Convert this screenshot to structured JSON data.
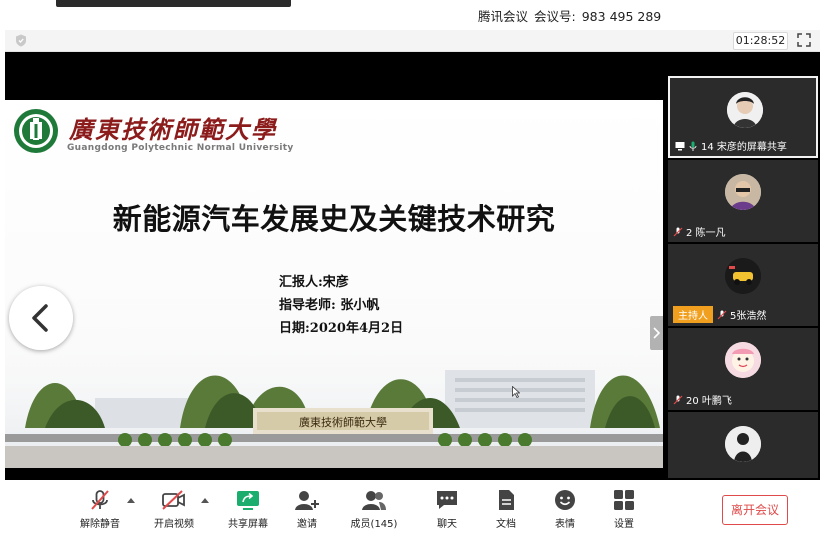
{
  "window": {
    "meeting_app": "腾讯会议",
    "meeting_id_label": "会议号:",
    "meeting_id": "983 495 289",
    "elapsed_time": "01:28:52"
  },
  "slide": {
    "university_cn": "廣東技術師範大學",
    "university_en": "Guangdong Polytechnic Normal University",
    "title": "新能源汽车发展史及关键技术研究",
    "lines": [
      "汇报人:宋彦",
      "指导老师: 张小帆",
      "日期:2020年4月2日"
    ],
    "gate_text": "廣東技術師範大學"
  },
  "participants": [
    {
      "name": "14 宋彦的屏幕共享",
      "sharing": true
    },
    {
      "name": "2 陈一凡",
      "muted": true
    },
    {
      "name": "5张浩然",
      "muted": true,
      "role": "主持人"
    },
    {
      "name": "20 叶鹏飞",
      "muted": true
    },
    {
      "name": "",
      "muted": true
    }
  ],
  "toolbar": {
    "items": [
      {
        "label": "解除静音",
        "icon": "mic-muted-icon"
      },
      {
        "label": "开启视频",
        "icon": "video-off-icon"
      },
      {
        "label": "共享屏幕",
        "icon": "share-screen-icon"
      },
      {
        "label": "邀请",
        "icon": "invite-icon"
      },
      {
        "label": "成员(145)",
        "icon": "members-icon"
      },
      {
        "label": "聊天",
        "icon": "chat-icon"
      },
      {
        "label": "文档",
        "icon": "document-icon"
      },
      {
        "label": "表情",
        "icon": "emoji-icon"
      },
      {
        "label": "设置",
        "icon": "settings-icon"
      }
    ],
    "leave_label": "离开会议"
  },
  "colors": {
    "accent_green": "#1aad6e",
    "leave_red": "#e04a4a",
    "host_orange": "#f0a01e",
    "brand_red": "#8c1c1c"
  }
}
